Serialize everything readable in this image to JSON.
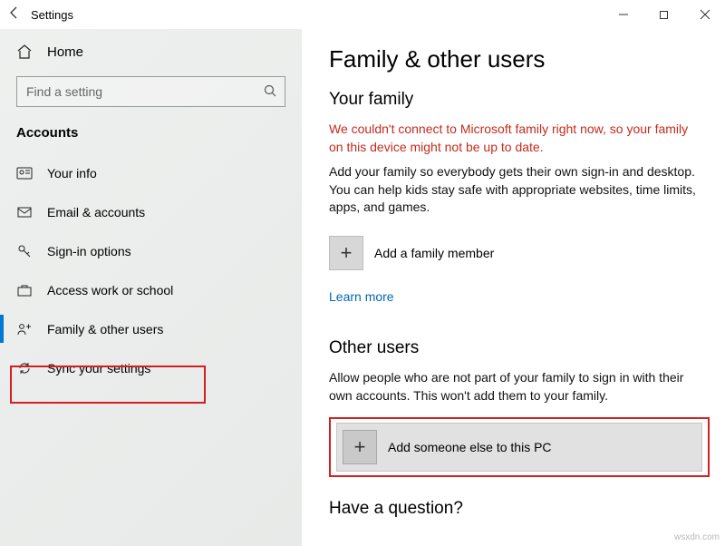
{
  "window": {
    "title": "Settings"
  },
  "sidebar": {
    "home": "Home",
    "search_placeholder": "Find a setting",
    "section": "Accounts",
    "items": [
      {
        "label": "Your info"
      },
      {
        "label": "Email & accounts"
      },
      {
        "label": "Sign-in options"
      },
      {
        "label": "Access work or school"
      },
      {
        "label": "Family & other users"
      },
      {
        "label": "Sync your settings"
      }
    ]
  },
  "main": {
    "title": "Family & other users",
    "family_heading": "Your family",
    "family_error": "We couldn't connect to Microsoft family right now, so your family on this device might not be up to date.",
    "family_desc": "Add your family so everybody gets their own sign-in and desktop. You can help kids stay safe with appropriate websites, time limits, apps, and games.",
    "add_family_label": "Add a family member",
    "learn_more": "Learn more",
    "other_heading": "Other users",
    "other_desc": "Allow people who are not part of your family to sign in with their own accounts. This won't add them to your family.",
    "add_other_label": "Add someone else to this PC",
    "question_heading": "Have a question?"
  },
  "watermark": "wsxdn.com"
}
